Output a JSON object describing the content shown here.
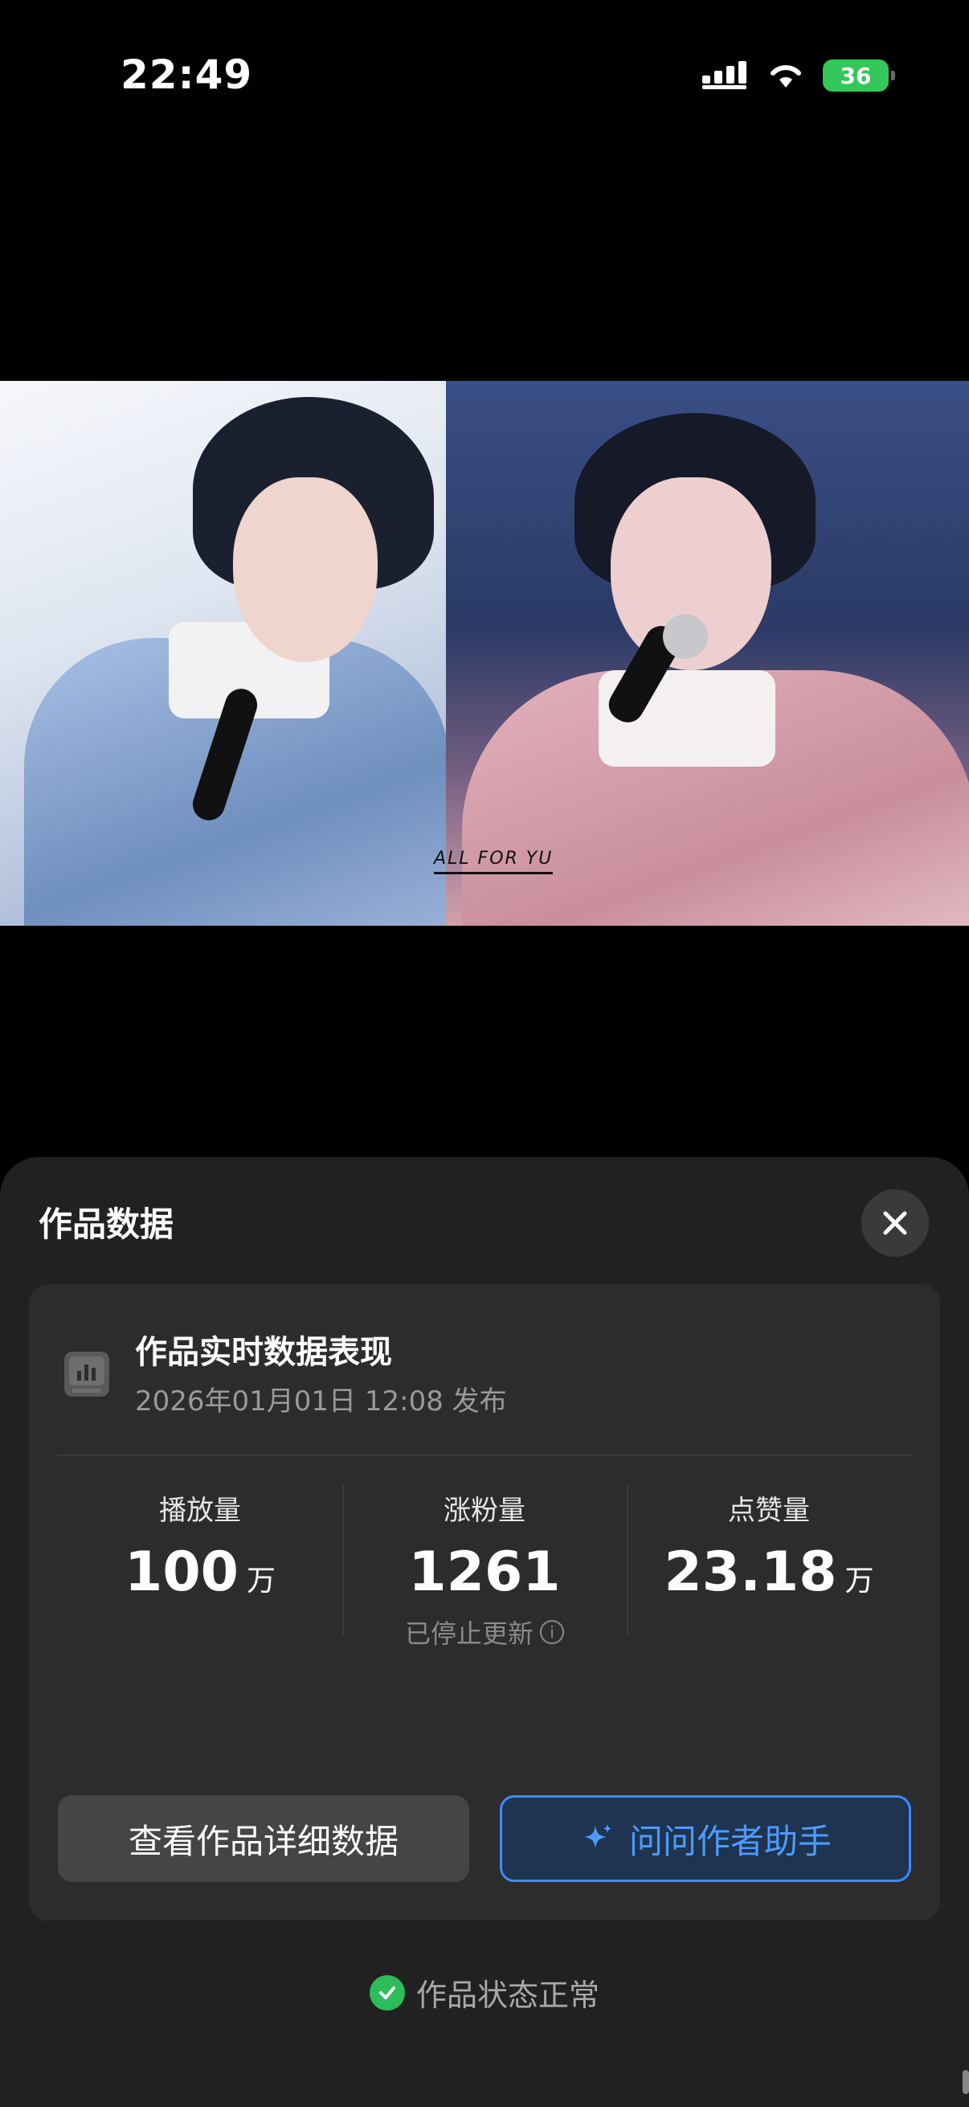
{
  "status_bar": {
    "time": "22:49",
    "battery": "36"
  },
  "media": {
    "watermark": "ALL FOR YU"
  },
  "sheet": {
    "title": "作品数据",
    "card": {
      "title": "作品实时数据表现",
      "published": "2026年01月01日 12:08 发布",
      "stats": [
        {
          "label": "播放量",
          "value": "100",
          "unit": "万",
          "note": ""
        },
        {
          "label": "涨粉量",
          "value": "1261",
          "unit": "",
          "note": "已停止更新"
        },
        {
          "label": "点赞量",
          "value": "23.18",
          "unit": "万",
          "note": ""
        }
      ],
      "detail_button": "查看作品详细数据",
      "ask_button": "问问作者助手"
    },
    "status_text": "作品状态正常"
  },
  "colors": {
    "accent": "#3b8cff",
    "success": "#2dbc5a",
    "battery": "#34c759"
  },
  "icons": [
    "signal-icon",
    "wifi-icon",
    "battery-icon",
    "close-icon",
    "chart-icon",
    "info-icon",
    "sparkle-icon",
    "check-icon"
  ]
}
